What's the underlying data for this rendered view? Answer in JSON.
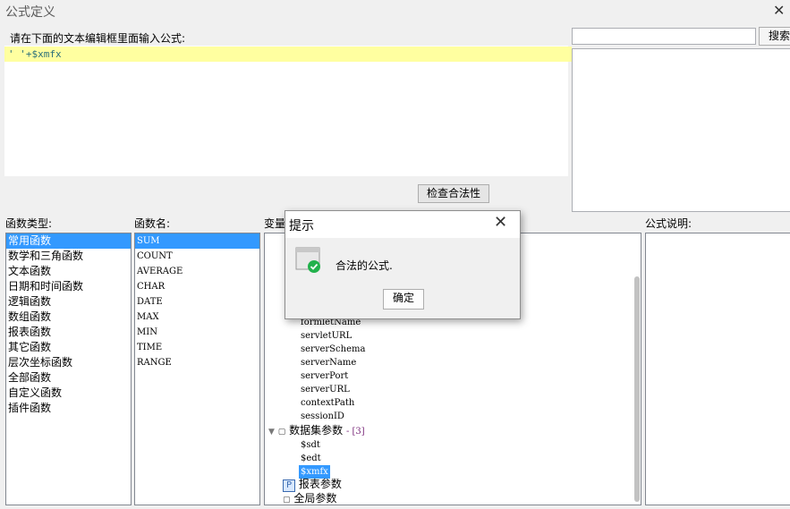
{
  "window": {
    "title": "公式定义"
  },
  "editor": {
    "prompt": "请在下面的文本编辑框里面输入公式:",
    "formula": "' '+$xmfx"
  },
  "search": {
    "value": "",
    "button": "搜索"
  },
  "check_button": "检查合法性",
  "function_types": {
    "label": "函数类型:",
    "items": [
      "常用函数",
      "数学和三角函数",
      "文本函数",
      "日期和时间函数",
      "逻辑函数",
      "数组函数",
      "报表函数",
      "其它函数",
      "层次坐标函数",
      "全部函数",
      "自定义函数",
      "插件函数"
    ],
    "selected_index": 0
  },
  "function_names": {
    "label": "函数名:",
    "items": [
      "SUM",
      "COUNT",
      "AVERAGE",
      "CHAR",
      "DATE",
      "MAX",
      "MIN",
      "TIME",
      "RANGE"
    ],
    "selected_index": 0
  },
  "variables": {
    "label": "变量",
    "leaves": [
      "formletName",
      "servletURL",
      "serverSchema",
      "serverName",
      "serverPort",
      "serverURL",
      "contextPath",
      "sessionID"
    ],
    "dataset_node": "数据集参数",
    "dataset_count": "- [3]",
    "dataset_params": [
      "$sdt",
      "$edt",
      "$xmfx"
    ],
    "report_params": "报表参数",
    "global_params": "全局参数"
  },
  "description": {
    "label": "公式说明:"
  },
  "dialog": {
    "title": "提示",
    "message": "合法的公式.",
    "ok": "确定"
  },
  "colors": {
    "selection": "#3399ff",
    "editor_highlight": "#ffffa0",
    "success_green": "#22b14c"
  }
}
